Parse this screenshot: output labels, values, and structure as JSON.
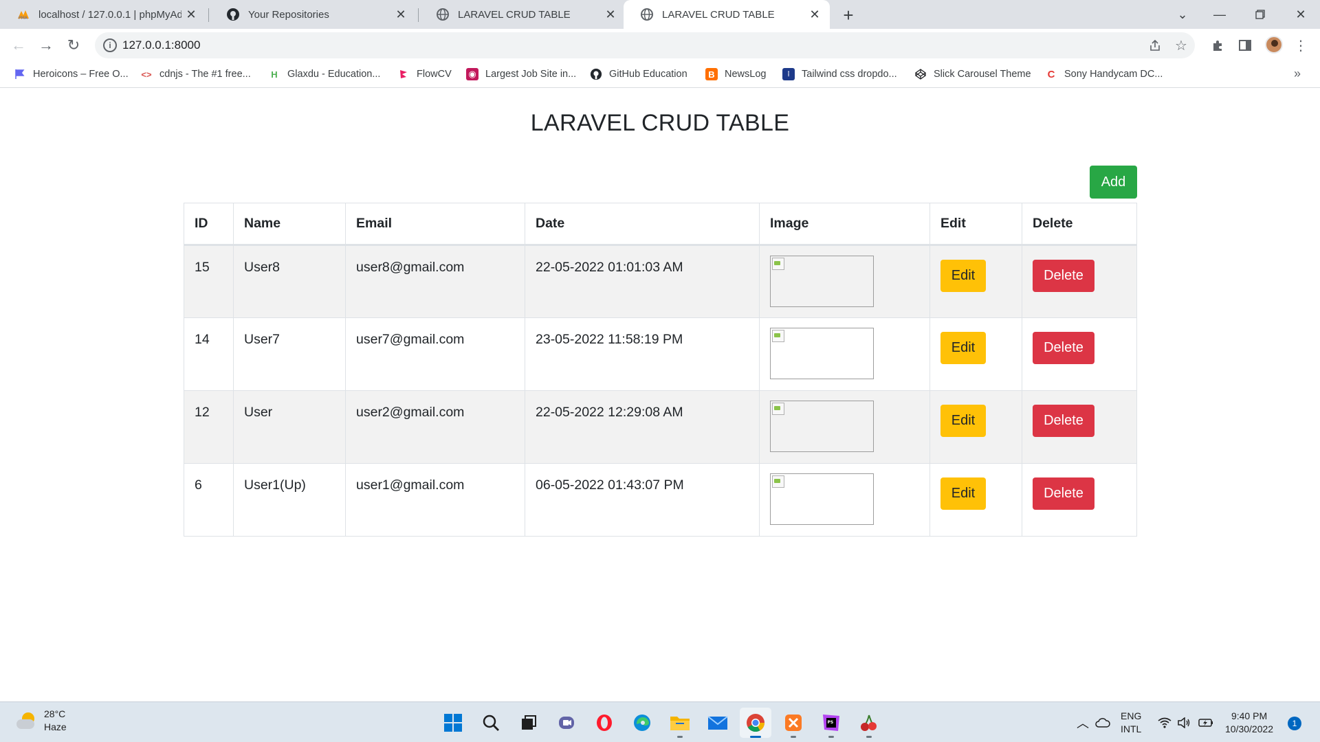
{
  "browser": {
    "tabs": [
      {
        "title": "localhost / 127.0.0.1 | phpMyAdm",
        "icon": "phpmyadmin-icon",
        "active": false
      },
      {
        "title": "Your Repositories",
        "icon": "github-icon",
        "active": false
      },
      {
        "title": "LARAVEL CRUD TABLE",
        "icon": "globe-icon",
        "active": false
      },
      {
        "title": "LARAVEL CRUD TABLE",
        "icon": "globe-icon",
        "active": true
      }
    ],
    "address": "127.0.0.1:8000",
    "bookmarks": [
      {
        "label": "Heroicons – Free O...",
        "icon": "flag-icon",
        "color": "#6366f1"
      },
      {
        "label": "cdnjs - The #1 free...",
        "icon": "code-brackets-icon",
        "color": "#d9534f"
      },
      {
        "label": "Glaxdu - Education...",
        "icon": "glaxdu-icon",
        "color": "#4caf50"
      },
      {
        "label": "FlowCV",
        "icon": "flowcv-icon",
        "color": "#e91e63"
      },
      {
        "label": "Largest Job Site in...",
        "icon": "job-site-icon",
        "color": "#c2185b"
      },
      {
        "label": "GitHub Education",
        "icon": "github-icon",
        "color": "#202124"
      },
      {
        "label": "NewsLog",
        "icon": "blogger-icon",
        "color": "#ff6f00"
      },
      {
        "label": "Tailwind css dropdo...",
        "icon": "tailwind-icon",
        "color": "#1e3a8a"
      },
      {
        "label": "Slick Carousel Theme",
        "icon": "codepen-icon",
        "color": "#202124"
      },
      {
        "label": "Sony Handycam DC...",
        "icon": "sony-icon",
        "color": "#e53935"
      }
    ]
  },
  "page": {
    "title": "LARAVEL CRUD TABLE",
    "add_label": "Add",
    "columns": [
      "ID",
      "Name",
      "Email",
      "Date",
      "Image",
      "Edit",
      "Delete"
    ],
    "rows": [
      {
        "id": "15",
        "name": "User8",
        "email": "user8@gmail.com",
        "date": "22-05-2022 01:01:03 AM"
      },
      {
        "id": "14",
        "name": "User7",
        "email": "user7@gmail.com",
        "date": "23-05-2022 11:58:19 PM"
      },
      {
        "id": "12",
        "name": "User",
        "email": "user2@gmail.com",
        "date": "22-05-2022 12:29:08 AM"
      },
      {
        "id": "6",
        "name": "User1(Up)",
        "email": "user1@gmail.com",
        "date": "06-05-2022 01:43:07 PM"
      }
    ],
    "edit_label": "Edit",
    "delete_label": "Delete",
    "colors": {
      "add": "#28a745",
      "edit": "#ffc107",
      "delete": "#dc3545"
    }
  },
  "taskbar": {
    "weather_temp": "28°C",
    "weather_desc": "Haze",
    "apps": [
      "windows-start-icon",
      "search-icon",
      "task-view-icon",
      "teams-chat-icon",
      "opera-icon",
      "edge-icon",
      "file-explorer-icon",
      "mail-icon",
      "chrome-icon",
      "xampp-icon",
      "phpstorm-icon",
      "cherry-icon"
    ],
    "lang_line1": "ENG",
    "lang_line2": "INTL",
    "time": "9:40 PM",
    "date": "10/30/2022",
    "notifications": "1"
  }
}
